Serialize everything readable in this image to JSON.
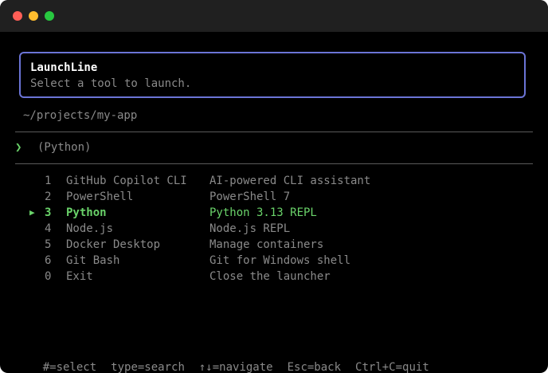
{
  "window": {
    "controls": [
      {
        "name": "close",
        "color": "#ff5f57"
      },
      {
        "name": "minimize",
        "color": "#febc2e"
      },
      {
        "name": "maximize",
        "color": "#28c840"
      }
    ]
  },
  "header": {
    "title": "LaunchLine",
    "subtitle": "Select a tool to launch."
  },
  "path": "~/projects/my-app",
  "prompt": {
    "symbol": "❯",
    "query": "(Python)"
  },
  "menu": {
    "selected_marker": "▶",
    "items": [
      {
        "number": "1",
        "name": "GitHub Copilot CLI",
        "description": "AI-powered CLI assistant",
        "selected": false
      },
      {
        "number": "2",
        "name": "PowerShell",
        "description": "PowerShell 7",
        "selected": false
      },
      {
        "number": "3",
        "name": "Python",
        "description": "Python 3.13 REPL",
        "selected": true
      },
      {
        "number": "4",
        "name": "Node.js",
        "description": "Node.js REPL",
        "selected": false
      },
      {
        "number": "5",
        "name": "Docker Desktop",
        "description": "Manage containers",
        "selected": false
      },
      {
        "number": "6",
        "name": "Git Bash",
        "description": "Git for Windows shell",
        "selected": false
      },
      {
        "number": "0",
        "name": "Exit",
        "description": "Close the launcher",
        "selected": false
      }
    ]
  },
  "footer": {
    "hints": [
      "#=select",
      "type=search",
      "↑↓=navigate",
      "Esc=back",
      "Ctrl+C=quit"
    ]
  },
  "colors": {
    "accent": "#6ad36a",
    "border": "#6b74d6",
    "text_dim": "#8a8a8a",
    "title": "#ffffff"
  }
}
